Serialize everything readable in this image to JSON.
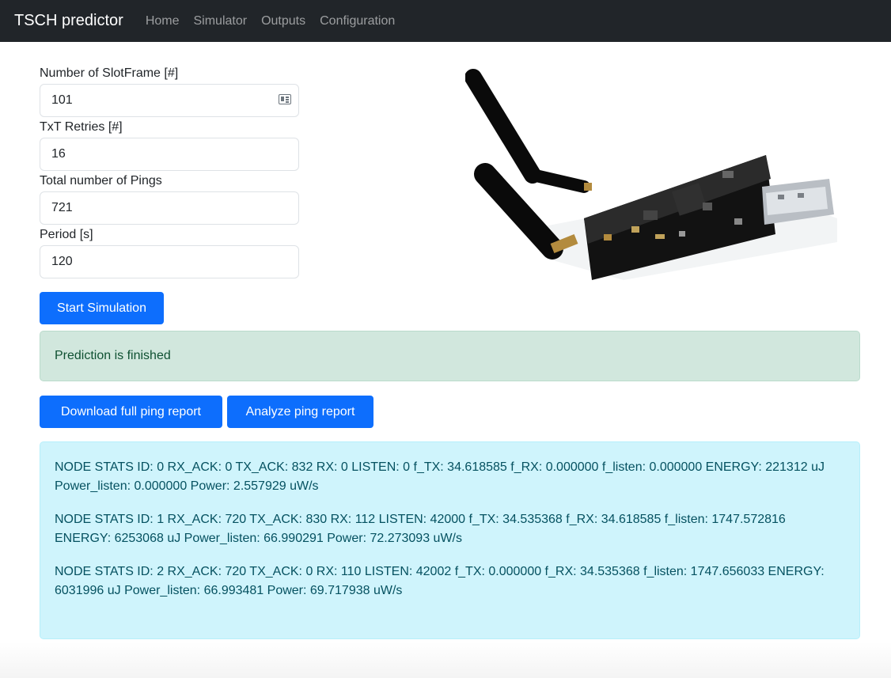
{
  "navbar": {
    "brand": "TSCH predictor",
    "links": [
      "Home",
      "Simulator",
      "Outputs",
      "Configuration"
    ]
  },
  "form": {
    "slotframe_label": "Number of SlotFrame [#]",
    "slotframe_value": "101",
    "retries_label": "TxT Retries [#]",
    "retries_value": "16",
    "pings_label": "Total number of Pings",
    "pings_value": "721",
    "period_label": "Period [s]",
    "period_value": "120"
  },
  "buttons": {
    "start": "Start Simulation",
    "download": "Download full ping report",
    "analyze": "Analyze ping report"
  },
  "status": {
    "message": "Prediction is finished"
  },
  "stats": [
    "NODE STATS ID: 0 RX_ACK: 0 TX_ACK: 832 RX: 0 LISTEN: 0 f_TX: 34.618585 f_RX: 0.000000 f_listen: 0.000000 ENERGY: 221312 uJ Power_listen: 0.000000 Power: 2.557929 uW/s",
    "NODE STATS ID: 1 RX_ACK: 720 TX_ACK: 830 RX: 112 LISTEN: 42000 f_TX: 34.535368 f_RX: 34.618585 f_listen: 1747.572816 ENERGY: 6253068 uJ Power_listen: 66.990291 Power: 72.273093 uW/s",
    "NODE STATS ID: 2 RX_ACK: 720 TX_ACK: 0 RX: 110 LISTEN: 42002 f_TX: 0.000000 f_RX: 34.535368 f_listen: 1747.656033 ENERGY: 6031996 uJ Power_listen: 66.993481 Power: 69.717938 uW/s"
  ],
  "colors": {
    "navbar_bg": "#212529",
    "primary": "#0d6efd",
    "success_bg": "#d1e7dd",
    "success_text": "#0f5132",
    "info_bg": "#cff4fc",
    "info_text": "#055160"
  },
  "icons": {
    "slotframe_field_icon": "contact-card-icon"
  }
}
